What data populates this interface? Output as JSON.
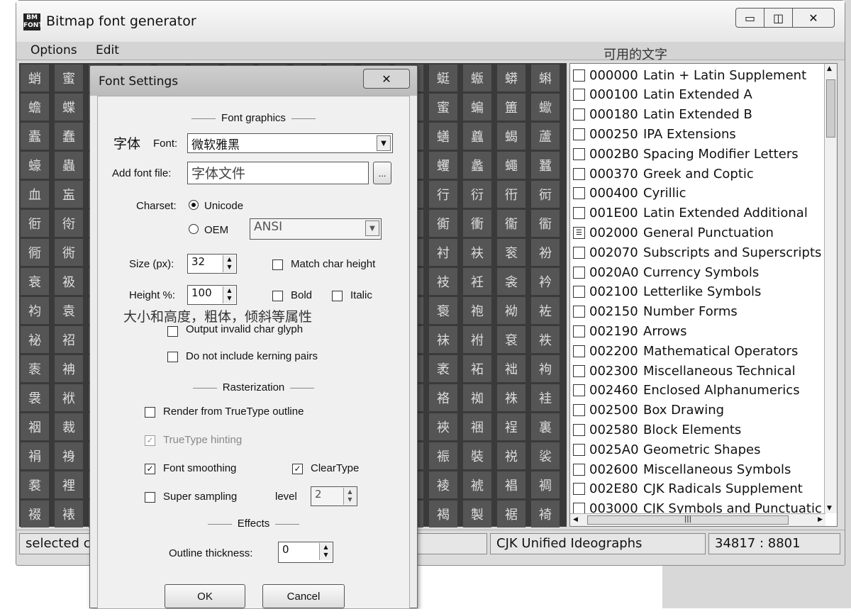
{
  "app": {
    "title": "Bitmap font generator",
    "icon_text": "BM FONT",
    "minimize": "▭",
    "maximize": "◫",
    "close": "✕"
  },
  "menu": {
    "options": "Options",
    "edit": "Edit"
  },
  "available_chars_label": "可用的文字",
  "grid_chars": [
    "蛸",
    "蜜",
    "",
    "",
    "",
    "",
    "",
    "",
    "",
    "",
    "",
    "",
    "蜓",
    "蝂",
    "蟒",
    "蝌",
    "蟾",
    "蝶",
    "",
    "",
    "",
    "",
    "",
    "",
    "",
    "",
    "",
    "",
    "蜜",
    "蝙",
    "簠",
    "蠍",
    "蠹",
    "蠢",
    "",
    "",
    "",
    "",
    "",
    "",
    "",
    "",
    "",
    "",
    "蟮",
    "蠤",
    "蝎",
    "蘆",
    "蠔",
    "蟲",
    "",
    "",
    "",
    "",
    "",
    "",
    "",
    "",
    "",
    "",
    "蠼",
    "蠡",
    "蠅",
    "蠶",
    "血",
    "衁",
    "",
    "",
    "",
    "",
    "",
    "",
    "",
    "",
    "",
    "",
    "行",
    "衍",
    "衎",
    "衏",
    "衐",
    "衑",
    "",
    "",
    "",
    "",
    "",
    "",
    "",
    "",
    "",
    "",
    "衠",
    "衝",
    "衞",
    "衟",
    "衕",
    "衖",
    "",
    "",
    "",
    "",
    "",
    "",
    "",
    "",
    "",
    "",
    "衬",
    "衭",
    "衮",
    "衯",
    "衰",
    "衱",
    "",
    "",
    "",
    "",
    "",
    "",
    "",
    "",
    "",
    "",
    "衼",
    "衽",
    "衾",
    "衿",
    "袀",
    "袁",
    "",
    "",
    "",
    "",
    "",
    "",
    "",
    "",
    "",
    "",
    "袌",
    "袍",
    "袎",
    "袏",
    "袐",
    "袑",
    "",
    "",
    "",
    "",
    "",
    "",
    "",
    "",
    "",
    "",
    "袜",
    "袝",
    "袞",
    "袟",
    "袠",
    "袡",
    "",
    "",
    "",
    "",
    "",
    "",
    "",
    "",
    "",
    "",
    "袤",
    "袥",
    "袦",
    "袧",
    "袰",
    "袱",
    "",
    "",
    "",
    "",
    "",
    "",
    "",
    "",
    "",
    "",
    "袼",
    "袽",
    "袾",
    "袿",
    "裀",
    "裁",
    "",
    "",
    "",
    "",
    "",
    "",
    "",
    "",
    "",
    "",
    "裌",
    "裍",
    "裎",
    "裏",
    "裐",
    "裑",
    "",
    "",
    "",
    "",
    "",
    "",
    "",
    "",
    "",
    "",
    "裖",
    "裝",
    "裞",
    "裟",
    "裠",
    "裡",
    "",
    "",
    "",
    "",
    "",
    "",
    "",
    "",
    "",
    "",
    "裬",
    "裭",
    "裮",
    "裯",
    "裰",
    "裱",
    "",
    "",
    "",
    "",
    "",
    "",
    "",
    "",
    "",
    "",
    "褐",
    "製",
    "裾",
    "裿"
  ],
  "char_ranges": [
    {
      "code": "000000",
      "name": "Latin + Latin Supplement",
      "icon": "empty"
    },
    {
      "code": "000100",
      "name": "Latin Extended A",
      "icon": "empty"
    },
    {
      "code": "000180",
      "name": "Latin Extended B",
      "icon": "empty"
    },
    {
      "code": "000250",
      "name": "IPA Extensions",
      "icon": "empty"
    },
    {
      "code": "0002B0",
      "name": "Spacing Modifier Letters",
      "icon": "empty"
    },
    {
      "code": "000370",
      "name": "Greek and Coptic",
      "icon": "empty"
    },
    {
      "code": "000400",
      "name": "Cyrillic",
      "icon": "empty"
    },
    {
      "code": "001E00",
      "name": "Latin Extended Additional",
      "icon": "empty"
    },
    {
      "code": "002000",
      "name": "General Punctuation",
      "icon": "partial"
    },
    {
      "code": "002070",
      "name": "Subscripts and Superscripts",
      "icon": "empty"
    },
    {
      "code": "0020A0",
      "name": "Currency Symbols",
      "icon": "empty"
    },
    {
      "code": "002100",
      "name": "Letterlike Symbols",
      "icon": "empty"
    },
    {
      "code": "002150",
      "name": "Number Forms",
      "icon": "empty"
    },
    {
      "code": "002190",
      "name": "Arrows",
      "icon": "empty"
    },
    {
      "code": "002200",
      "name": "Mathematical Operators",
      "icon": "empty"
    },
    {
      "code": "002300",
      "name": "Miscellaneous Technical",
      "icon": "empty"
    },
    {
      "code": "002460",
      "name": "Enclosed Alphanumerics",
      "icon": "empty"
    },
    {
      "code": "002500",
      "name": "Box Drawing",
      "icon": "empty"
    },
    {
      "code": "002580",
      "name": "Block Elements",
      "icon": "empty"
    },
    {
      "code": "0025A0",
      "name": "Geometric Shapes",
      "icon": "empty"
    },
    {
      "code": "002600",
      "name": "Miscellaneous Symbols",
      "icon": "empty"
    },
    {
      "code": "002E80",
      "name": "CJK Radicals Supplement",
      "icon": "empty"
    },
    {
      "code": "003000",
      "name": "CJK Symbols and Punctuatic",
      "icon": "empty"
    }
  ],
  "status": {
    "selected": "selected c",
    "range": "CJK Unified Ideographs",
    "counts": "34817 : 8801"
  },
  "dialog": {
    "title": "Font Settings",
    "close": "✕",
    "font_graphics_header": "Font graphics",
    "font_label_cn": "字体",
    "font_label": "Font:",
    "font_value": "微软雅黑",
    "add_font_label": "Add font file:",
    "add_font_value": "字体文件",
    "browse": "...",
    "charset_label": "Charset:",
    "unicode_label": "Unicode",
    "oem_label": "OEM",
    "oem_value": "ANSI",
    "size_label": "Size (px):",
    "size_value": "32",
    "match_char_height": "Match char height",
    "height_label": "Height %:",
    "height_value": "100",
    "bold_label": "Bold",
    "italic_label": "Italic",
    "annotation": "大小和高度，粗体，倾斜等属性",
    "output_invalid": "Output invalid char glyph",
    "no_kerning": "Do not include kerning pairs",
    "rasterization_header": "Rasterization",
    "render_truetype": "Render from TrueType outline",
    "truetype_hinting": "TrueType hinting",
    "font_smoothing": "Font smoothing",
    "cleartype": "ClearType",
    "super_sampling": "Super sampling",
    "level_label": "level",
    "level_value": "2",
    "effects_header": "Effects",
    "outline_label": "Outline thickness:",
    "outline_value": "0",
    "ok": "OK",
    "cancel": "Cancel"
  }
}
